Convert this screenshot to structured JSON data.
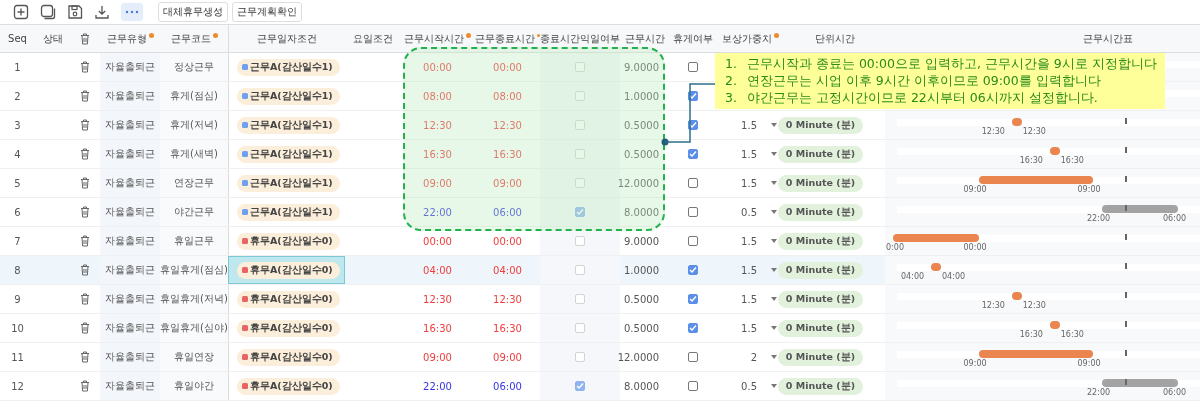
{
  "toolbar": {
    "buttons": [
      "대체휴무생성",
      "근무계획확인"
    ]
  },
  "columns": [
    {
      "label": "Seq"
    },
    {
      "label": "상태"
    },
    {
      "kind": "delete"
    },
    {
      "label": "근무유형",
      "required": true
    },
    {
      "label": "근무코드",
      "required": true
    },
    {
      "label": "근무일자조건"
    },
    {
      "label": "요일조건"
    },
    {
      "label": "근무시작시간",
      "required": true
    },
    {
      "label": "근무종료시간",
      "required": true
    },
    {
      "label": "종료시간익일여부"
    },
    {
      "label": "근무시간"
    },
    {
      "label": "휴게여부"
    },
    {
      "label": "보상가중치",
      "required": true
    },
    {
      "label": "단위시간"
    },
    {
      "label": "근무시간표"
    }
  ],
  "rows": [
    {
      "seq": "1",
      "type": "자율출퇴근",
      "code": "정상근무",
      "date_condition": {
        "label": "근무A(감산일수1)",
        "color": "#6fa0f0"
      },
      "start": "00:00",
      "end": "00:00",
      "next_day": false,
      "hours": "9.0000",
      "rest": false,
      "selected": false
    },
    {
      "seq": "2",
      "type": "자율출퇴근",
      "code": "휴게(점심)",
      "date_condition": {
        "label": "근무A(감산일수1)",
        "color": "#6fa0f0"
      },
      "start": "08:00",
      "end": "08:00",
      "next_day": false,
      "hours": "1.0000",
      "rest": true,
      "selected": false
    },
    {
      "seq": "3",
      "type": "자율출퇴근",
      "code": "휴게(저녁)",
      "date_condition": {
        "label": "근무A(감산일수1)",
        "color": "#6fa0f0"
      },
      "start": "12:30",
      "end": "12:30",
      "next_day": false,
      "hours": "0.5000",
      "rest": true,
      "weight": "1.5",
      "unit": "0 Minute (분)",
      "timeline": {
        "start_label": "12:30",
        "end_label": "12:30"
      },
      "selected": false
    },
    {
      "seq": "4",
      "type": "자율출퇴근",
      "code": "휴게(새벽)",
      "date_condition": {
        "label": "근무A(감산일수1)",
        "color": "#6fa0f0"
      },
      "start": "16:30",
      "end": "16:30",
      "next_day": false,
      "hours": "0.5000",
      "rest": true,
      "weight": "1.5",
      "unit": "0 Minute (분)",
      "timeline": {
        "start_label": "16:30",
        "end_label": "16:30"
      },
      "selected": false
    },
    {
      "seq": "5",
      "type": "자율출퇴근",
      "code": "연장근무",
      "date_condition": {
        "label": "근무A(감산일수1)",
        "color": "#6fa0f0"
      },
      "start": "09:00",
      "end": "09:00",
      "next_day": false,
      "hours": "12.0000",
      "rest": false,
      "weight": "1.5",
      "unit": "0 Minute (분)",
      "timeline": {
        "start_label": "09:00",
        "end_label": "09:00"
      },
      "selected": false
    },
    {
      "seq": "6",
      "type": "자율출퇴근",
      "code": "야간근무",
      "date_condition": {
        "label": "근무A(감산일수1)",
        "color": "#6fa0f0"
      },
      "start": "22:00",
      "end": "06:00",
      "next_day": true,
      "hours": "8.0000",
      "rest": false,
      "weight": "0.5",
      "unit": "0 Minute (분)",
      "timeline": {
        "start_label": "22:00",
        "end_label": "06:00"
      },
      "selected": false
    },
    {
      "seq": "7",
      "type": "자율출퇴근",
      "code": "휴일근무",
      "date_condition": {
        "label": "휴무A(감산일수0)",
        "color": "#e86464"
      },
      "start": "00:00",
      "end": "00:00",
      "next_day": false,
      "hours": "9.0000",
      "rest": false,
      "weight": "1.5",
      "unit": "0 Minute (분)",
      "timeline": {
        "start_label": "0:00",
        "end_label": "00:00"
      },
      "selected": false
    },
    {
      "seq": "8",
      "type": "자율출퇴근",
      "code": "휴일휴게(점심)",
      "date_condition": {
        "label": "휴무A(감산일수0)",
        "color": "#e86464"
      },
      "start": "04:00",
      "end": "04:00",
      "next_day": false,
      "hours": "1.0000",
      "rest": true,
      "weight": "1.5",
      "unit": "0 Minute (분)",
      "timeline": {
        "start_label": "04:00",
        "end_label": "04:00"
      },
      "selected": true
    },
    {
      "seq": "9",
      "type": "자율출퇴근",
      "code": "휴일휴게(저녁)",
      "date_condition": {
        "label": "휴무A(감산일수0)",
        "color": "#e86464"
      },
      "start": "12:30",
      "end": "12:30",
      "next_day": false,
      "hours": "0.5000",
      "rest": true,
      "weight": "1.5",
      "unit": "0 Minute (분)",
      "timeline": {
        "start_label": "12:30",
        "end_label": "12:30"
      },
      "selected": false
    },
    {
      "seq": "10",
      "type": "자율출퇴근",
      "code": "휴일휴게(심야)",
      "date_condition": {
        "label": "휴무A(감산일수0)",
        "color": "#e86464"
      },
      "start": "16:30",
      "end": "16:30",
      "next_day": false,
      "hours": "0.5000",
      "rest": true,
      "weight": "1.5",
      "unit": "0 Minute (분)",
      "timeline": {
        "start_label": "16:30",
        "end_label": "16:30"
      },
      "selected": false
    },
    {
      "seq": "11",
      "type": "자율출퇴근",
      "code": "휴일연장",
      "date_condition": {
        "label": "휴무A(감산일수0)",
        "color": "#e86464"
      },
      "start": "09:00",
      "end": "09:00",
      "next_day": false,
      "hours": "12.0000",
      "rest": false,
      "weight": "2",
      "unit": "0 Minute (분)",
      "timeline": {
        "start_label": "09:00",
        "end_label": "09:00"
      },
      "selected": false
    },
    {
      "seq": "12",
      "type": "자율출퇴근",
      "code": "휴일야간",
      "date_condition": {
        "label": "휴무A(감산일수0)",
        "color": "#e86464"
      },
      "start": "22:00",
      "end": "06:00",
      "next_day": true,
      "hours": "8.0000",
      "rest": false,
      "weight": "0.5",
      "unit": "0 Minute (분)",
      "timeline": {
        "start_label": "22:00",
        "end_label": "06:00"
      },
      "selected": false
    }
  ],
  "callout": {
    "items": [
      {
        "number": "1.",
        "text": "근무시작과 종료는 00:00으로 입력하고, 근무시간을 9시로 지정합니다"
      },
      {
        "number": "2.",
        "text": "연장근무는 시업 이후 9시간 이후이므로 09:00를 입력합니다"
      },
      {
        "number": "3.",
        "text": "야간근무는 고정시간이므로 22시부터 06시까지 설정합니다."
      }
    ]
  }
}
